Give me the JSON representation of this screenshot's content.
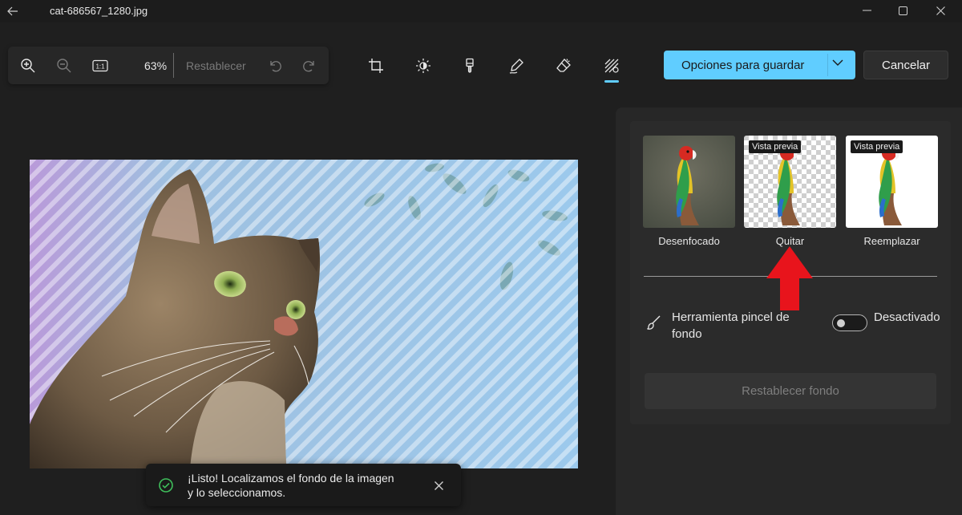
{
  "window": {
    "title": "cat-686567_1280.jpg",
    "icons": {
      "back": "back-arrow-icon",
      "minimize": "minimize-icon",
      "maximize": "maximize-icon",
      "close": "close-icon"
    }
  },
  "zoom_toolbar": {
    "zoom_level": "63%",
    "reset_label": "Restablecer",
    "actual_size_label": "1:1",
    "icons": [
      "zoom-in-icon",
      "zoom-out-icon",
      "actual-size-icon",
      "undo-icon",
      "redo-icon"
    ]
  },
  "edit_tools": {
    "items": [
      "crop-icon",
      "brightness-icon",
      "filter-brush-icon",
      "markup-pen-icon",
      "erase-icon",
      "background-icon"
    ],
    "selected": "background-icon",
    "accent_color": "#60cdff"
  },
  "actions": {
    "save_label": "Opciones para guardar",
    "cancel_label": "Cancelar"
  },
  "toast": {
    "line1": "¡Listo! Localizamos el fondo de la imagen",
    "line2": "y lo seleccionamos.",
    "success_color": "#3fbf5b"
  },
  "background_panel": {
    "options": [
      {
        "label": "Desenfocado",
        "badge": ""
      },
      {
        "label": "Quitar",
        "badge": "Vista previa"
      },
      {
        "label": "Reemplazar",
        "badge": "Vista previa"
      }
    ],
    "brush_tool_label": "Herramienta pincel de fondo",
    "toggle_state_label": "Desactivado",
    "toggle_on": false,
    "reset_background_label": "Restablecer fondo"
  },
  "annotation": {
    "arrow_color": "#e8141c"
  }
}
